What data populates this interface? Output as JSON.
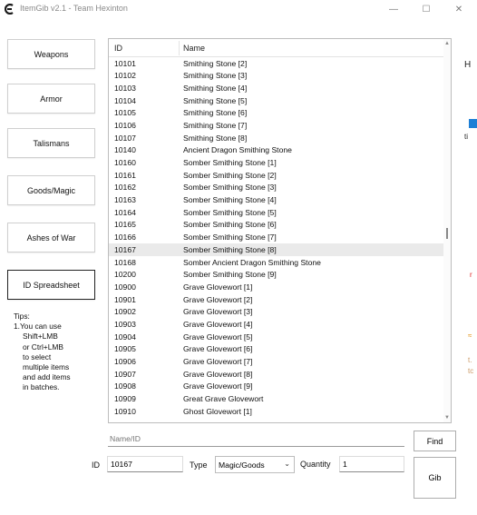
{
  "window": {
    "title": "ItemGib v2.1 - Team Hexinton",
    "minimize_glyph": "—",
    "maximize_glyph": "☐",
    "close_glyph": "✕"
  },
  "nav": {
    "weapons": "Weapons",
    "armor": "Armor",
    "talismans": "Talismans",
    "goods_magic": "Goods/Magic",
    "ashes_of_war": "Ashes of War",
    "id_spreadsheet": "ID Spreadsheet"
  },
  "tips": {
    "title": "Tips:",
    "lines": [
      "1.You can use",
      "Shift+LMB",
      "or Ctrl+LMB",
      "to select",
      "multiple items",
      "and add items",
      "in batches."
    ]
  },
  "grid": {
    "headers": {
      "id": "ID",
      "name": "Name"
    },
    "selected_id": "10167",
    "rows": [
      {
        "id": "10101",
        "name": "Smithing Stone [2]"
      },
      {
        "id": "10102",
        "name": "Smithing Stone [3]"
      },
      {
        "id": "10103",
        "name": "Smithing Stone [4]"
      },
      {
        "id": "10104",
        "name": "Smithing Stone [5]"
      },
      {
        "id": "10105",
        "name": "Smithing Stone [6]"
      },
      {
        "id": "10106",
        "name": "Smithing Stone [7]"
      },
      {
        "id": "10107",
        "name": "Smithing Stone [8]"
      },
      {
        "id": "10140",
        "name": "Ancient Dragon Smithing Stone"
      },
      {
        "id": "10160",
        "name": "Somber Smithing Stone [1]"
      },
      {
        "id": "10161",
        "name": "Somber Smithing Stone [2]"
      },
      {
        "id": "10162",
        "name": "Somber Smithing Stone [3]"
      },
      {
        "id": "10163",
        "name": "Somber Smithing Stone [4]"
      },
      {
        "id": "10164",
        "name": "Somber Smithing Stone [5]"
      },
      {
        "id": "10165",
        "name": "Somber Smithing Stone [6]"
      },
      {
        "id": "10166",
        "name": "Somber Smithing Stone [7]"
      },
      {
        "id": "10167",
        "name": "Somber Smithing Stone [8]"
      },
      {
        "id": "10168",
        "name": "Somber Ancient Dragon Smithing Stone"
      },
      {
        "id": "10200",
        "name": "Somber Smithing Stone [9]"
      },
      {
        "id": "10900",
        "name": "Grave Glovewort [1]"
      },
      {
        "id": "10901",
        "name": "Grave Glovewort [2]"
      },
      {
        "id": "10902",
        "name": "Grave Glovewort [3]"
      },
      {
        "id": "10903",
        "name": "Grave Glovewort [4]"
      },
      {
        "id": "10904",
        "name": "Grave Glovewort [5]"
      },
      {
        "id": "10905",
        "name": "Grave Glovewort [6]"
      },
      {
        "id": "10906",
        "name": "Grave Glovewort [7]"
      },
      {
        "id": "10907",
        "name": "Grave Glovewort [8]"
      },
      {
        "id": "10908",
        "name": "Grave Glovewort [9]"
      },
      {
        "id": "10909",
        "name": "Great Grave Glovewort"
      },
      {
        "id": "10910",
        "name": "Ghost Glovewort [1]"
      }
    ]
  },
  "search": {
    "placeholder": "Name/ID",
    "find_label": "Find"
  },
  "form": {
    "id_label": "ID",
    "id_value": "10167",
    "type_label": "Type",
    "type_value": "Magic/Goods",
    "quantity_label": "Quantity",
    "quantity_value": "1",
    "gib_label": "Gib"
  },
  "colors": {
    "selected_row": "#eaeaea",
    "app_icon": "#1a1a1a"
  }
}
